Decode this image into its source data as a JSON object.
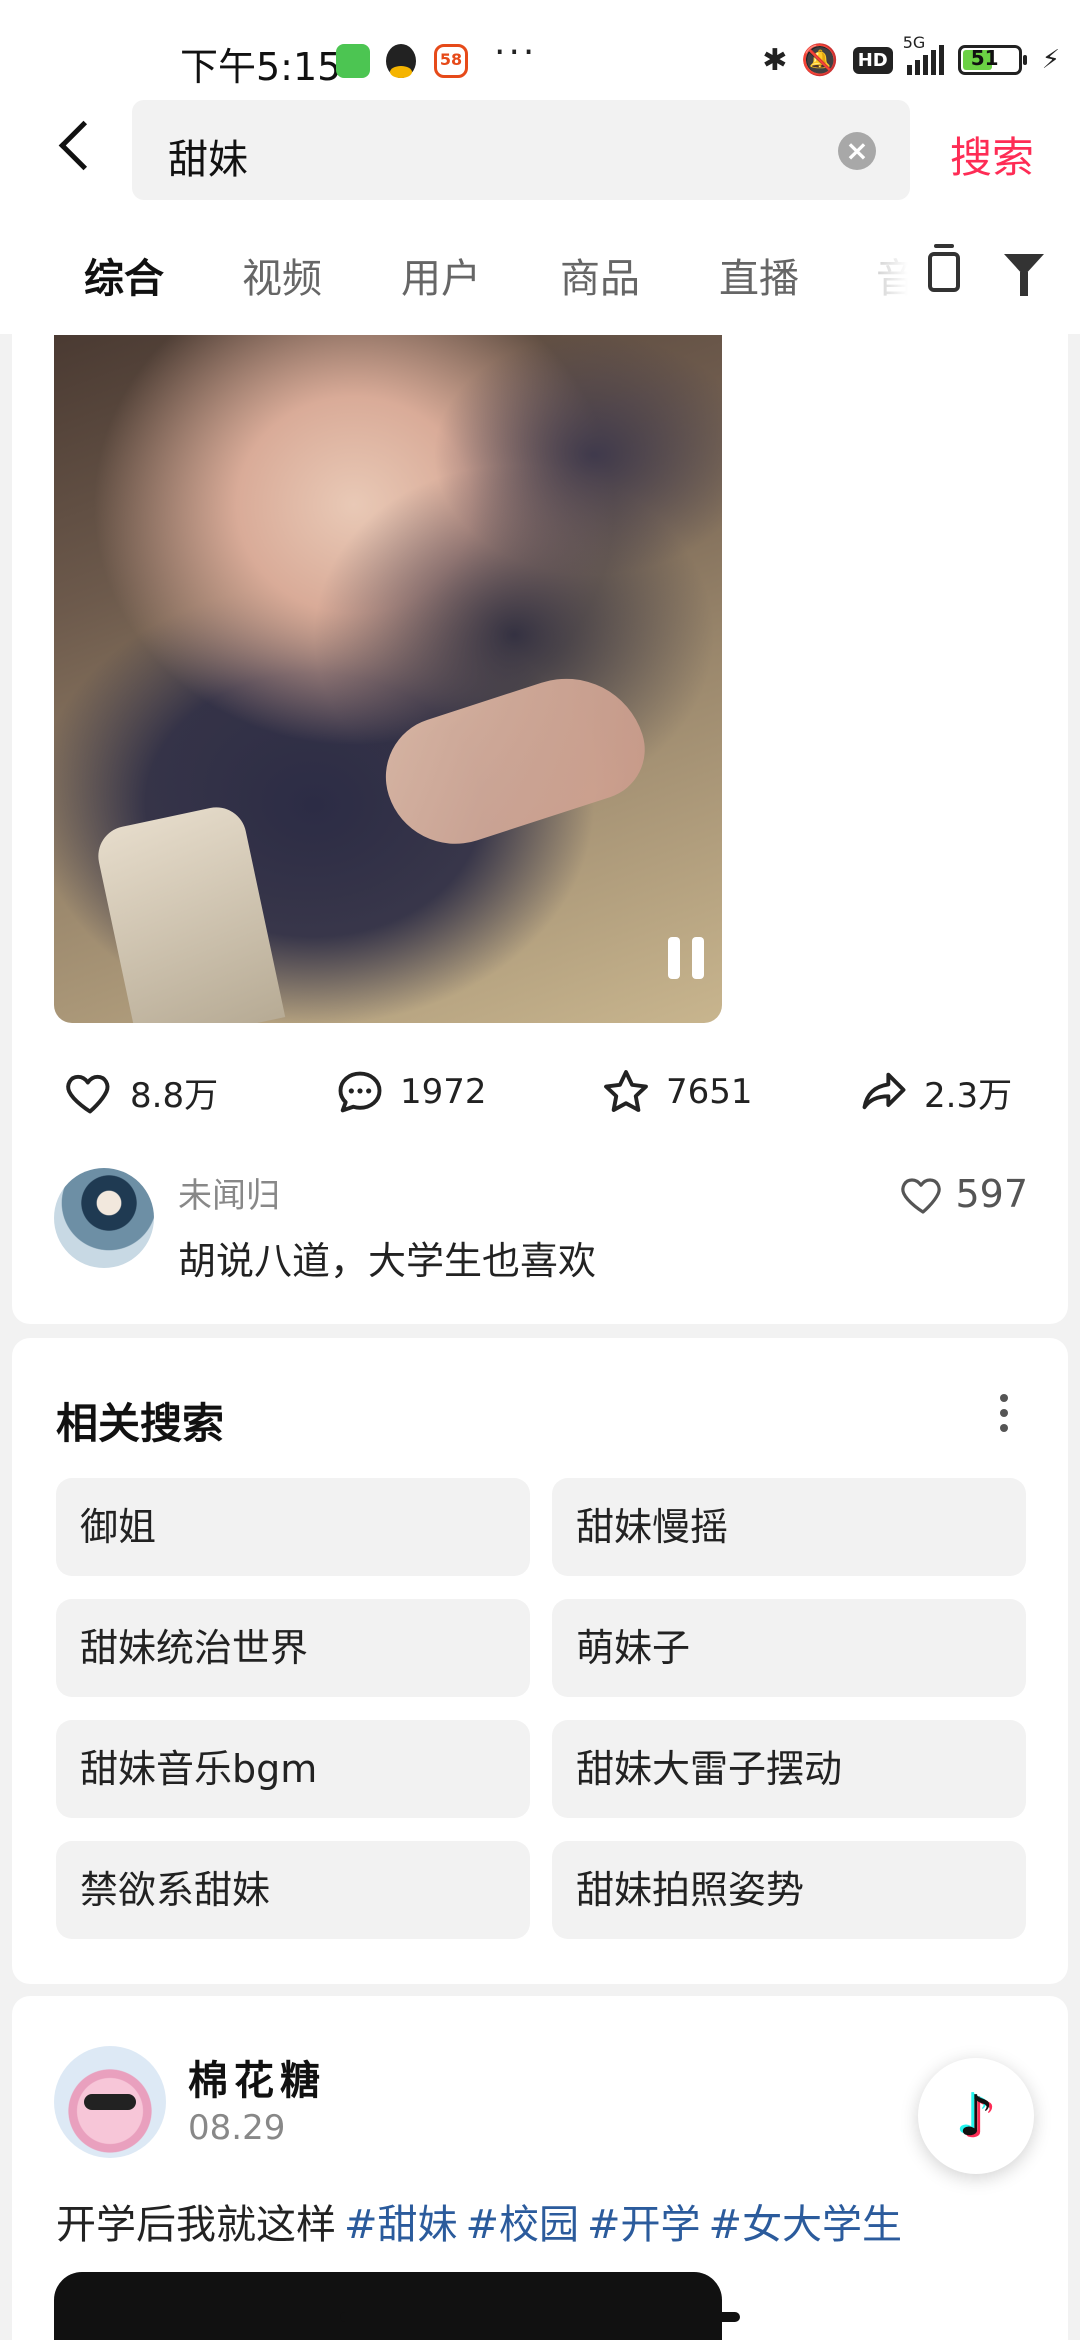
{
  "status_bar": {
    "time": "下午5:15",
    "app_58_label": "58",
    "dots": "···",
    "hd": "HD",
    "network": "5G",
    "battery": "51",
    "icons": [
      "bluetooth-icon",
      "mute-icon",
      "charging-icon"
    ]
  },
  "search": {
    "query": "甜妹",
    "clear_icon": "×",
    "submit_label": "搜索"
  },
  "tabs": [
    "综合",
    "视频",
    "用户",
    "商品",
    "直播",
    "音"
  ],
  "video": {
    "likes": "8.8万",
    "comments": "1972",
    "favorites": "7651",
    "shares": "2.3万"
  },
  "top_comment": {
    "user": "未闻归",
    "text": "胡说八道，大学生也喜欢",
    "likes": "597"
  },
  "related": {
    "title": "相关搜索",
    "items": [
      "御姐",
      "甜妹慢摇",
      "甜妹统治世界",
      "萌妹子",
      "甜妹音乐bgm",
      "甜妹大雷子摆动",
      "禁欲系甜妹",
      "甜妹拍照姿势"
    ]
  },
  "post": {
    "author": "棉花糖",
    "date": "08.29",
    "text": "开学后我就这样",
    "hashtags": [
      "#甜妹",
      "#校园",
      "#开学",
      "#女大学生"
    ]
  },
  "float_button": {
    "glyph": "♪"
  },
  "colors": {
    "accent": "#fe2c55",
    "hashtag": "#2b5b9c",
    "chip_bg": "#f2f2f2",
    "page_bg": "#f2f2f2"
  }
}
